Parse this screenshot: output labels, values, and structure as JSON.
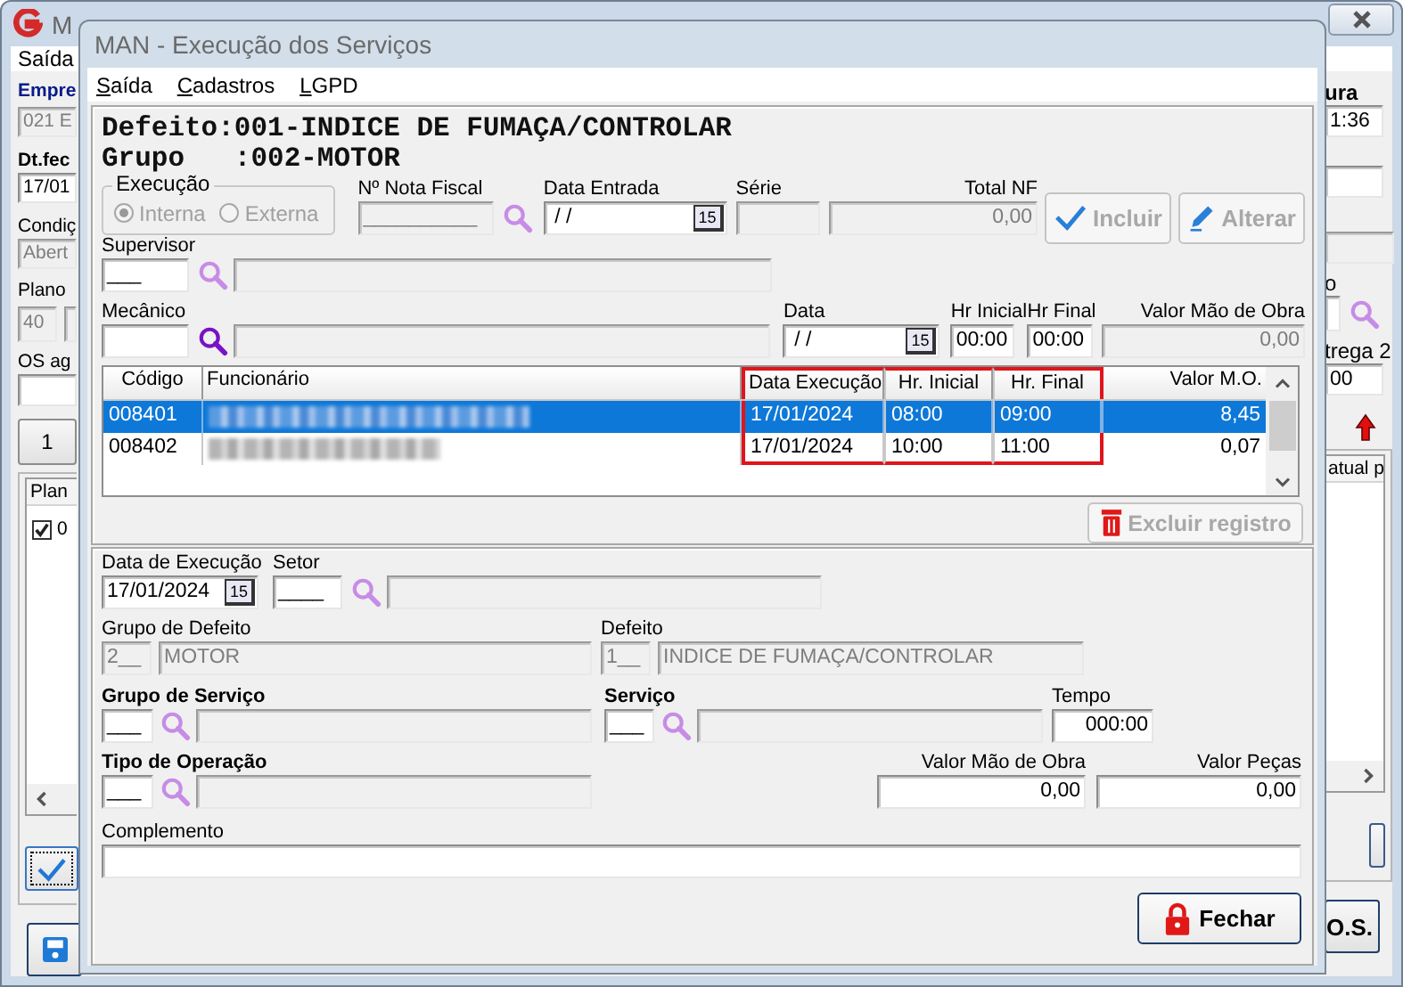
{
  "main_window": {
    "title": "M",
    "menu": [
      {
        "label": "Saída"
      }
    ],
    "left": {
      "empresa_label": "Empre",
      "empresa": "021 E",
      "dt_label": "Dt.fec",
      "dt": "17/01",
      "cond_label": "Condiç",
      "cond": "Abert",
      "plano_label": "Plano",
      "plano": "40",
      "os_label": "OS ag",
      "page_button": "1",
      "list_header": "Plan",
      "list_items": [
        {
          "text": "0",
          "checked": true
        }
      ]
    },
    "right": {
      "hora_label": "ura",
      "hora": "1:36",
      "field_label": "o",
      "entrega_label": "trega 2",
      "entrega": "00",
      "list_header": "atual p",
      "os_button": "O.S."
    }
  },
  "dialog": {
    "title": "MAN - Execução dos Serviços",
    "menu": [
      {
        "label": "Saída"
      },
      {
        "label": "Cadastros"
      },
      {
        "label": "LGPD"
      }
    ],
    "header": [
      "Defeito:001-INDICE DE FUMAÇA/CONTROLAR",
      "Grupo   :002-MOTOR"
    ],
    "execucao": {
      "label": "Execução",
      "disabled": true,
      "options": [
        {
          "label": "Interna",
          "selected": true
        },
        {
          "label": "Externa",
          "selected": false
        }
      ]
    },
    "nota_fiscal": {
      "label": "Nº Nota Fiscal",
      "value": "__________"
    },
    "data_entrada": {
      "label": "Data Entrada",
      "value": " / /",
      "calendar": "15"
    },
    "serie": {
      "label": "Série"
    },
    "total_nf": {
      "label": "Total NF",
      "value": "0,00"
    },
    "buttons": [
      {
        "label": "Incluir",
        "kind": "include",
        "disabled": true
      },
      {
        "label": "Alterar",
        "kind": "edit",
        "disabled": true
      }
    ],
    "supervisor": {
      "label": "Supervisor",
      "code": "___"
    },
    "mecanico": {
      "label": "Mecânico"
    },
    "data": {
      "label": "Data",
      "value": " / /",
      "calendar": "15"
    },
    "hr_inicial": {
      "label": "Hr Inicial",
      "value": "00:00"
    },
    "hr_final": {
      "label": "Hr Final",
      "value": "00:00"
    },
    "valor_mao_obra": {
      "label": "Valor Mão de Obra",
      "value": "0,00"
    },
    "table": {
      "columns": [
        "Código",
        "Funcionário",
        "Data Execução",
        "Hr. Inicial",
        "Hr. Final",
        "Valor M.O."
      ],
      "rows": [
        {
          "codigo": "008401",
          "data": "17/01/2024",
          "hr_inicial": "08:00",
          "hr_final": "09:00",
          "valor": "8,45",
          "selected": true
        },
        {
          "codigo": "008402",
          "data": "17/01/2024",
          "hr_inicial": "10:00",
          "hr_final": "11:00",
          "valor": "0,07",
          "selected": false
        }
      ]
    },
    "delete_button": {
      "label": "Excluir registro",
      "disabled": true
    },
    "data_execucao": {
      "label": "Data de Execução",
      "value": "17/01/2024",
      "calendar": "15"
    },
    "setor": {
      "label": "Setor",
      "code": "____"
    },
    "grupo_defeito": {
      "label": "Grupo de Defeito",
      "code": "2__",
      "name": "MOTOR"
    },
    "defeito": {
      "label": "Defeito",
      "code": "1__",
      "name": "INDICE DE FUMAÇA/CONTROLAR"
    },
    "grupo_servico": {
      "label": "Grupo de Serviço",
      "code": "___"
    },
    "servico": {
      "label": "Serviço",
      "code": "___"
    },
    "tempo": {
      "label": "Tempo",
      "value": "000:00"
    },
    "tipo_operacao": {
      "label": "Tipo de Operação",
      "code": "___"
    },
    "valor_mao_obra_2": {
      "label": "Valor Mão de Obra",
      "value": "0,00"
    },
    "valor_pecas": {
      "label": "Valor Peças",
      "value": "0,00"
    },
    "complemento": {
      "label": "Complemento"
    },
    "close_button": {
      "label": "Fechar"
    }
  }
}
